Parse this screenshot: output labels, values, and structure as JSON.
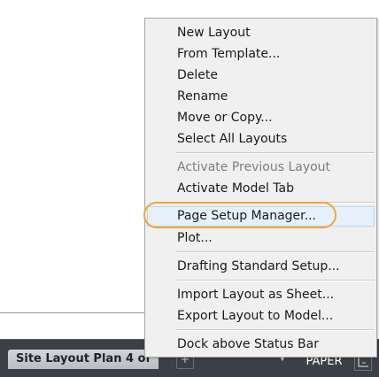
{
  "status_bar": {
    "layout_tab_label": "Site Layout Plan 4 of",
    "add_tab_glyph": "+",
    "chevron_glyph": "▼",
    "paper_label": "PAPER"
  },
  "icons": {
    "chevron": "chevron-down-icon",
    "snap": "snap-grid-icon"
  },
  "colors": {
    "highlight_ring": "#eea73b",
    "status_bar": "#3b3f46",
    "menu_background": "#f0f0f0"
  },
  "context_menu": {
    "groups": [
      {
        "items": [
          {
            "label": "New Layout",
            "enabled": true
          },
          {
            "label": "From Template...",
            "enabled": true
          },
          {
            "label": "Delete",
            "enabled": true
          },
          {
            "label": "Rename",
            "enabled": true
          },
          {
            "label": "Move or Copy...",
            "enabled": true
          },
          {
            "label": "Select All Layouts",
            "enabled": true
          }
        ]
      },
      {
        "items": [
          {
            "label": "Activate Previous Layout",
            "enabled": false
          },
          {
            "label": "Activate Model Tab",
            "enabled": true
          }
        ]
      },
      {
        "items": [
          {
            "label": "Page Setup Manager...",
            "enabled": true,
            "highlighted": true
          },
          {
            "label": "Plot...",
            "enabled": true
          }
        ]
      },
      {
        "items": [
          {
            "label": "Drafting Standard Setup...",
            "enabled": true
          }
        ]
      },
      {
        "items": [
          {
            "label": "Import Layout as Sheet...",
            "enabled": true
          },
          {
            "label": "Export Layout to Model...",
            "enabled": true
          }
        ]
      },
      {
        "items": [
          {
            "label": "Dock above Status Bar",
            "enabled": true
          }
        ]
      }
    ]
  }
}
